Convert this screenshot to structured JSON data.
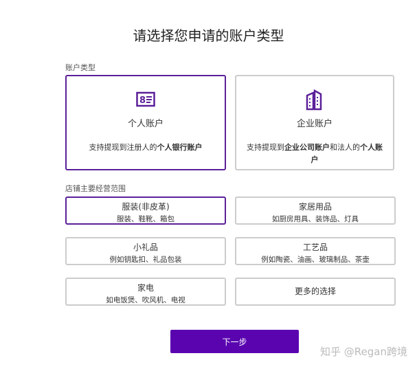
{
  "title": "请选择您申请的账户类型",
  "account_label": "账户类型",
  "accounts": [
    {
      "name": "个人账户",
      "desc_pre": "支持提现到注册人的",
      "desc_bold": "个人银行账户",
      "desc_mid": "",
      "desc_bold2": "",
      "selected": true
    },
    {
      "name": "企业账户",
      "desc_pre": "支持提现到",
      "desc_bold": "企业公司账户",
      "desc_mid": "和法人的",
      "desc_bold2": "个人账户",
      "selected": false
    }
  ],
  "scope_label": "店铺主要经营范围",
  "categories": [
    {
      "name": "服装(非皮革)",
      "sub": "服装、鞋靴、箱包"
    },
    {
      "name": "家居用品",
      "sub": "如厨房用具、装饰品、灯具"
    },
    {
      "name": "小礼品",
      "sub": "例如钥匙扣、礼品包装"
    },
    {
      "name": "工艺品",
      "sub": "例如陶瓷、油画、玻璃制品、茶壶"
    },
    {
      "name": "家电",
      "sub": "如电饭煲、吹风机、电视"
    },
    {
      "name": "更多的选择"
    }
  ],
  "next_label": "下一步",
  "watermark": "知乎 @Regan跨境",
  "accent": "#5a04b0"
}
